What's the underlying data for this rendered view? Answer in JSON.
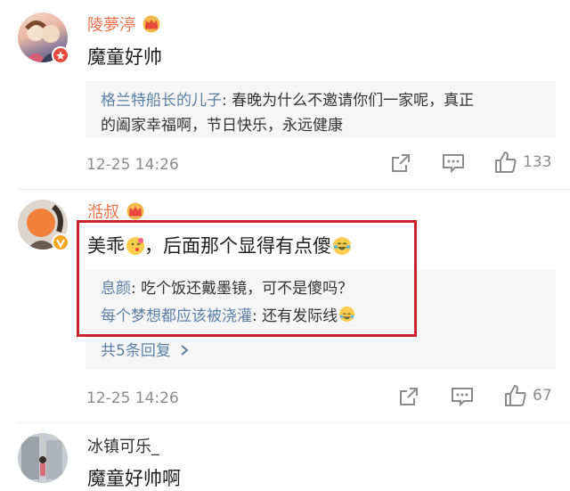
{
  "comments": [
    {
      "username": "陵夢渟",
      "text": "魔童好帅",
      "replies": [
        {
          "name": "格兰特船长的儿子",
          "text": ": 春晚为什么不邀请你们一家呢，真正",
          "text2": "的阖家幸福啊，节日快乐，永远健康"
        }
      ],
      "time": "12-25 14:26",
      "likes": "133"
    },
    {
      "username": "湉叔",
      "text_part1": "美乖",
      "text_part2": "，后面那个显得有点傻",
      "replies": [
        {
          "name": "息颜",
          "text": ": 吃个饭还戴墨镜，可不是傻吗？"
        },
        {
          "name": "每个梦想都应该被浇灌",
          "text": ": 还有发际线"
        }
      ],
      "more_replies": "共5条回复",
      "time": "12-25 14:26",
      "likes": "67"
    },
    {
      "username": "冰镇可乐_",
      "text": "魔童好帅啊"
    }
  ],
  "icons": {
    "share": "share-icon",
    "comment": "comment-icon",
    "like": "thumbs-up-icon",
    "crown": "crown-badge-icon",
    "verified": "verified-badge-icon",
    "chevron": "chevron-right-icon",
    "emoji_kiss": "kiss-emoji-icon",
    "emoji_laugh": "laugh-cry-emoji-icon"
  },
  "colors": {
    "username": "#eb7350",
    "reply_name": "#5b7fa6",
    "meta": "#8c8c8c",
    "highlight_border": "#c8222b"
  }
}
